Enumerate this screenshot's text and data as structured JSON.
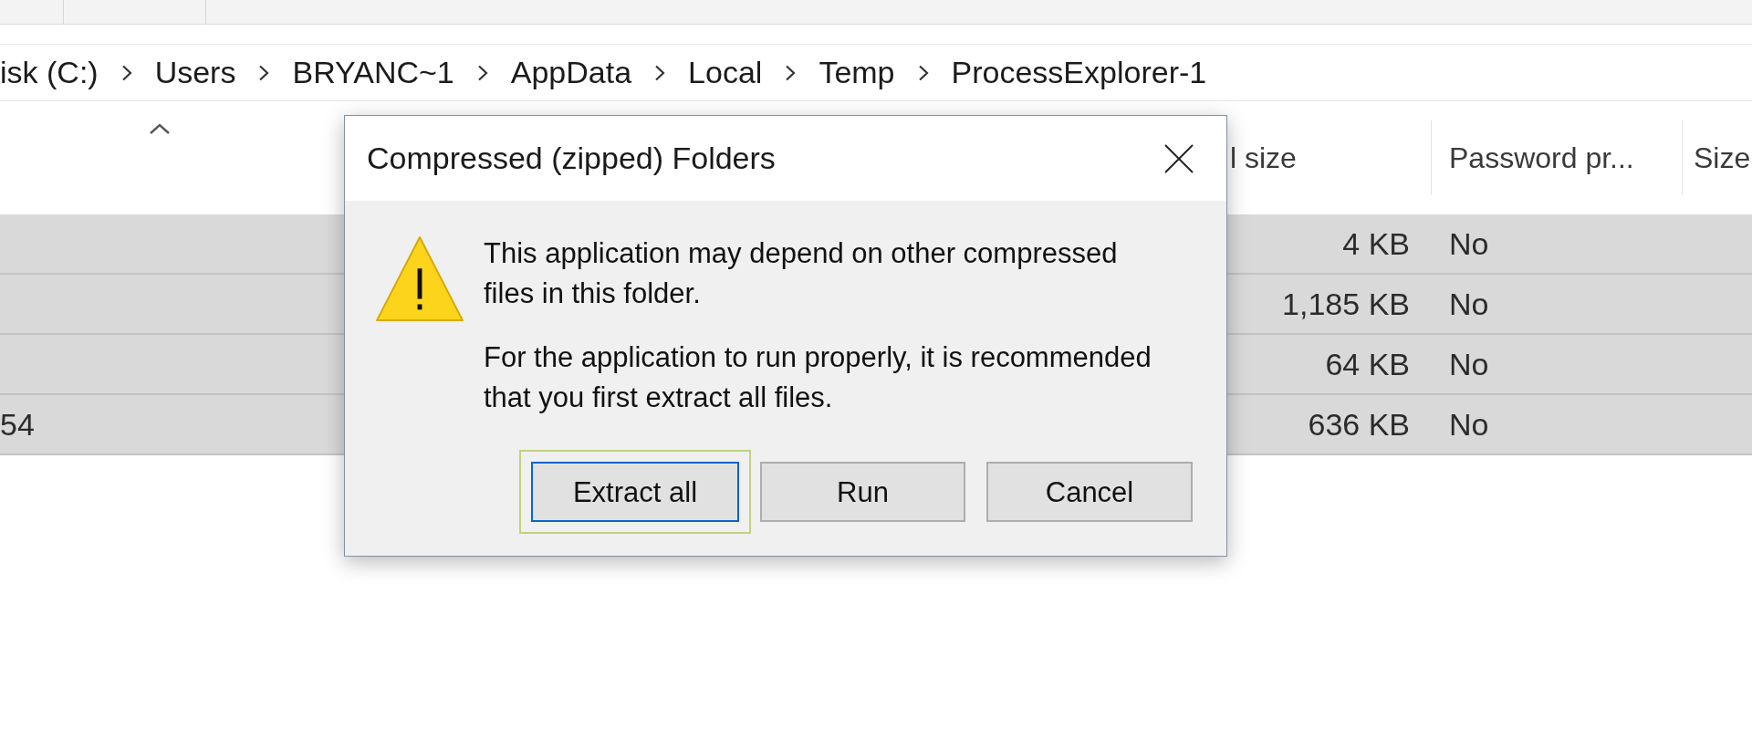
{
  "address_bar": {
    "breadcrumbs": [
      "isk (C:)",
      "Users",
      "BRYANC~1",
      "AppData",
      "Local",
      "Temp",
      "ProcessExplorer-1"
    ]
  },
  "file_list": {
    "columns": [
      {
        "sorted": true
      },
      {
        "label": "l size",
        "sorted": false
      },
      {
        "label": "Password pr...",
        "sorted": false
      },
      {
        "label": "Size",
        "sorted": false
      }
    ],
    "rows": [
      {
        "selected": true,
        "column_2": "4 KB",
        "column_3": "No"
      },
      {
        "selected": true,
        "column_2": "1,185 KB",
        "column_3": "No"
      },
      {
        "selected": true,
        "column_2": "64 KB",
        "column_3": "No"
      },
      {
        "selected": true,
        "column_1": "54",
        "column_2": "636 KB",
        "column_3": "No"
      }
    ]
  },
  "dialog": {
    "title": "Compressed (zipped) Folders",
    "messages": [
      "This application may depend on other compressed files in this folder.",
      "For the application to run properly, it is recommended that you first extract all files."
    ],
    "buttons": [
      {
        "label": "Extract all",
        "default": true,
        "highlighted": true
      },
      {
        "label": "Run",
        "default": false,
        "highlighted": false
      },
      {
        "label": "Cancel",
        "default": false,
        "highlighted": false
      }
    ]
  }
}
